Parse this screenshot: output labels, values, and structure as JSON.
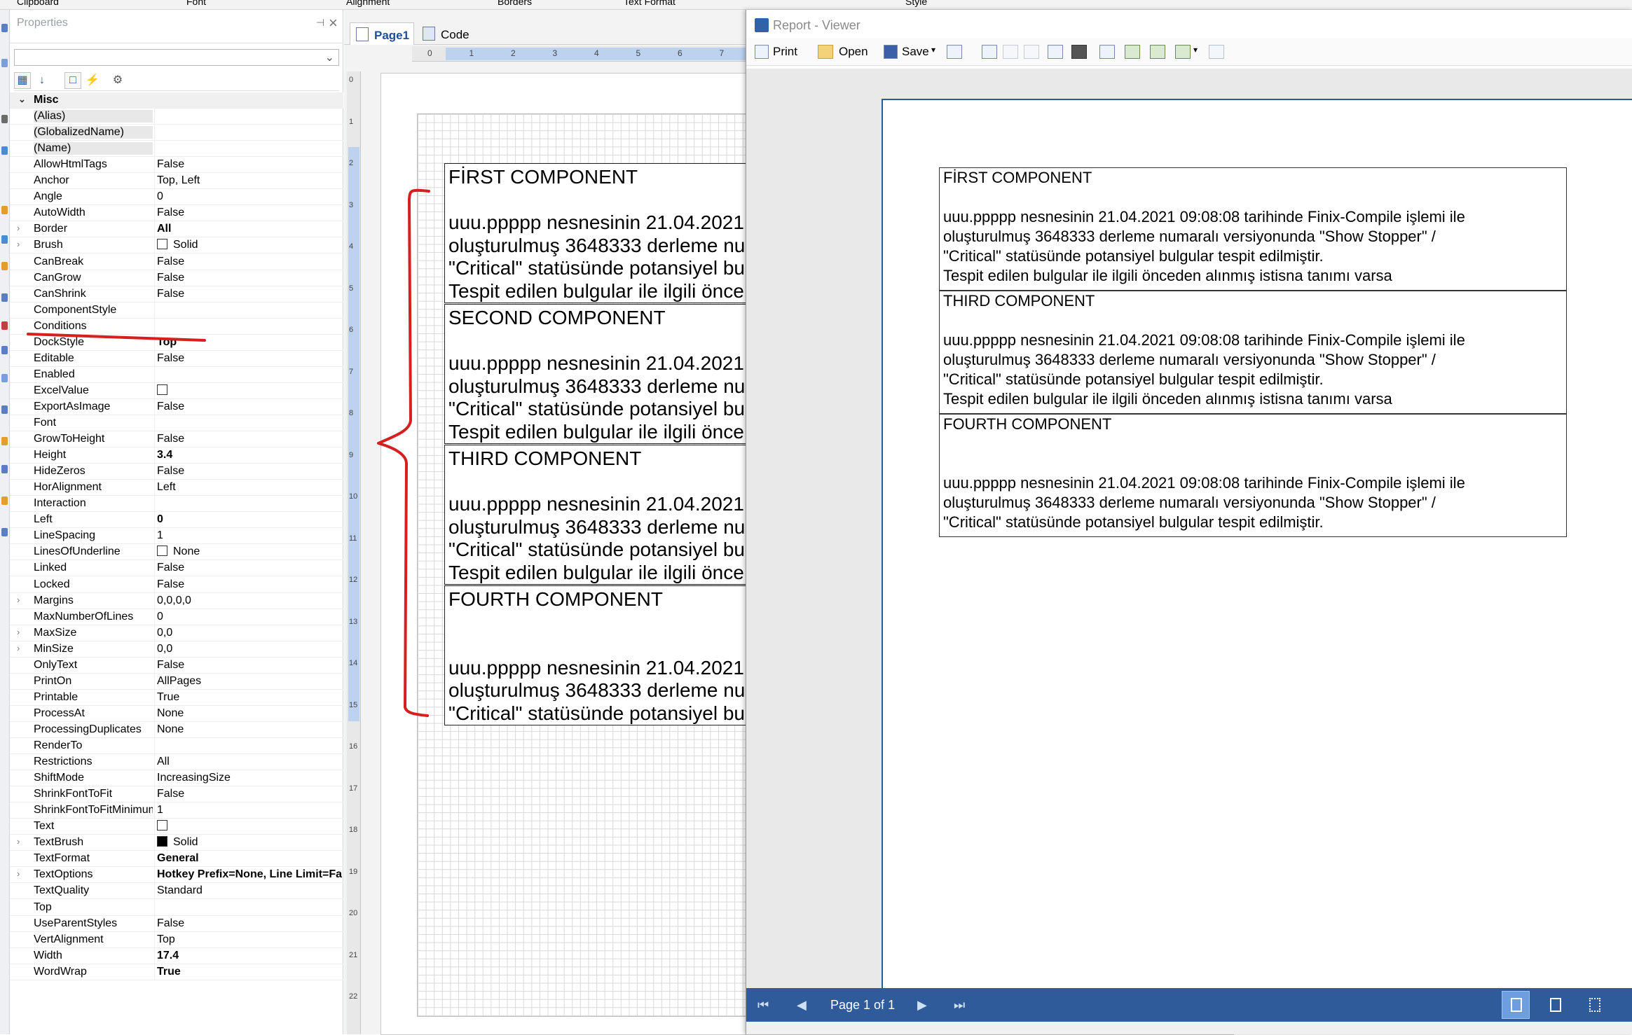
{
  "ribbon": {
    "groups": [
      "Clipboard",
      "Font",
      "Alignment",
      "Borders",
      "Text Format",
      "Style"
    ]
  },
  "properties": {
    "title": "Properties",
    "pin_icon": "pin-icon",
    "close_icon": "close-icon",
    "category": "Misc",
    "rows": [
      {
        "name": "(Alias)",
        "value": ""
      },
      {
        "name": "(GlobalizedName)",
        "value": ""
      },
      {
        "name": "(Name)",
        "value": ""
      },
      {
        "name": "AllowHtmlTags",
        "value": "False"
      },
      {
        "name": "Anchor",
        "value": "Top, Left"
      },
      {
        "name": "Angle",
        "value": "0"
      },
      {
        "name": "AutoWidth",
        "value": "False"
      },
      {
        "name": "Border",
        "value": "All"
      },
      {
        "name": "Brush",
        "value": "Solid"
      },
      {
        "name": "CanBreak",
        "value": "False"
      },
      {
        "name": "CanGrow",
        "value": "False"
      },
      {
        "name": "CanShrink",
        "value": "False"
      },
      {
        "name": "ComponentStyle",
        "value": ""
      },
      {
        "name": "Conditions",
        "value": ""
      },
      {
        "name": "DockStyle",
        "value": "Top"
      },
      {
        "name": "Editable",
        "value": "False"
      },
      {
        "name": "Enabled",
        "value": ""
      },
      {
        "name": "ExcelValue",
        "value": ""
      },
      {
        "name": "ExportAsImage",
        "value": "False"
      },
      {
        "name": "Font",
        "value": ""
      },
      {
        "name": "GrowToHeight",
        "value": "False"
      },
      {
        "name": "Height",
        "value": "3.4"
      },
      {
        "name": "HideZeros",
        "value": "False"
      },
      {
        "name": "HorAlignment",
        "value": "Left"
      },
      {
        "name": "Interaction",
        "value": ""
      },
      {
        "name": "Left",
        "value": "0"
      },
      {
        "name": "LineSpacing",
        "value": "1"
      },
      {
        "name": "LinesOfUnderline",
        "value": "None"
      },
      {
        "name": "Linked",
        "value": "False"
      },
      {
        "name": "Locked",
        "value": "False"
      },
      {
        "name": "Margins",
        "value": "0,0,0,0"
      },
      {
        "name": "MaxNumberOfLines",
        "value": "0"
      },
      {
        "name": "MaxSize",
        "value": "0,0"
      },
      {
        "name": "MinSize",
        "value": "0,0"
      },
      {
        "name": "OnlyText",
        "value": "False"
      },
      {
        "name": "PrintOn",
        "value": "AllPages"
      },
      {
        "name": "Printable",
        "value": "True"
      },
      {
        "name": "ProcessAt",
        "value": "None"
      },
      {
        "name": "ProcessingDuplicates",
        "value": "None"
      },
      {
        "name": "RenderTo",
        "value": ""
      },
      {
        "name": "Restrictions",
        "value": "All"
      },
      {
        "name": "ShiftMode",
        "value": "IncreasingSize"
      },
      {
        "name": "ShrinkFontToFit",
        "value": "False"
      },
      {
        "name": "ShrinkFontToFitMinimum",
        "value": "1"
      },
      {
        "name": "Text",
        "value": ""
      },
      {
        "name": "TextBrush",
        "value": "Solid"
      },
      {
        "name": "TextFormat",
        "value": "General"
      },
      {
        "name": "TextOptions",
        "value": "Hotkey Prefix=None, Line Limit=False"
      },
      {
        "name": "TextQuality",
        "value": "Standard"
      },
      {
        "name": "Top",
        "value": ""
      },
      {
        "name": "UseParentStyles",
        "value": "False"
      },
      {
        "name": "VertAlignment",
        "value": "Top"
      },
      {
        "name": "Width",
        "value": "17.4"
      },
      {
        "name": "WordWrap",
        "value": "True"
      }
    ]
  },
  "designer": {
    "tabs": [
      "Page1",
      "Code"
    ],
    "hruler": [
      "0",
      "1",
      "2",
      "3",
      "4",
      "5",
      "6",
      "7"
    ],
    "vruler": [
      "0",
      "1",
      "2",
      "3",
      "4",
      "5",
      "6",
      "7",
      "8",
      "9",
      "10",
      "11",
      "12",
      "13",
      "14",
      "15",
      "16",
      "17",
      "18",
      "19",
      "20",
      "21",
      "22"
    ],
    "components": [
      {
        "title": "FİRST COMPONENT",
        "lines": [
          "",
          "uuu.ppppp nesnesinin 21.04.2021",
          "oluşturulmuş 3648333 derleme nu",
          "\"Critical\" statüsünde potansiyel bu",
          "Tespit edilen bulgular ile ilgili önce"
        ]
      },
      {
        "title": "SECOND COMPONENT",
        "lines": [
          "",
          "uuu.ppppp nesnesinin 21.04.2021",
          "oluşturulmuş 3648333 derleme nu",
          "\"Critical\" statüsünde potansiyel bu",
          "Tespit edilen bulgular ile ilgili önce"
        ]
      },
      {
        "title": "THIRD  COMPONENT",
        "lines": [
          "",
          "uuu.ppppp nesnesinin 21.04.2021",
          "oluşturulmuş 3648333 derleme nu",
          "\"Critical\" statüsünde potansiyel bu",
          "Tespit edilen bulgular ile ilgili önce"
        ]
      },
      {
        "title": "FOURTH COMPONENT",
        "lines": [
          "",
          "",
          "uuu.ppppp nesnesinin 21.04.2021",
          "oluşturulmuş 3648333 derleme nu",
          "\"Critical\" statüsünde potansiyel bu"
        ]
      }
    ]
  },
  "viewer": {
    "title": "Report - Viewer",
    "toolbar": {
      "print": "Print",
      "open": "Open",
      "save": "Save"
    },
    "components": [
      {
        "title": "FİRST COMPONENT",
        "lines": [
          "",
          "uuu.ppppp  nesnesinin  21.04.2021  09:08:08  tarihinde  Finix-Compile  işlemi  ile",
          "oluşturulmuş  3648333  derleme  numaralı  versiyonunda  \"Show  Stopper\"  /",
          "\"Critical\" statüsünde potansiyel bulgular tespit edilmiştir.",
          "Tespit edilen bulgular ile ilgili önceden alınmış istisna tanımı varsa"
        ]
      },
      {
        "title": "THIRD  COMPONENT",
        "lines": [
          "",
          "uuu.ppppp  nesnesinin  21.04.2021  09:08:08  tarihinde  Finix-Compile  işlemi  ile",
          "oluşturulmuş  3648333  derleme  numaralı  versiyonunda  \"Show  Stopper\"  /",
          "\"Critical\" statüsünde potansiyel bulgular tespit edilmiştir.",
          "Tespit edilen bulgular ile ilgili önceden alınmış istisna tanımı varsa"
        ]
      },
      {
        "title": "FOURTH COMPONENT",
        "lines": [
          "",
          "",
          "uuu.ppppp  nesnesinin  21.04.2021  09:08:08  tarihinde  Finix-Compile  işlemi  ile",
          "oluşturulmuş  3648333  derleme  numaralı  versiyonunda  \"Show  Stopper\"  /",
          "\"Critical\" statüsünde potansiyel bulgular tespit edilmiştir."
        ]
      }
    ],
    "status": {
      "page_label": "Page 1 of 1"
    }
  },
  "colors": {
    "accent": "#2f5b9a",
    "annotation": "#d62020",
    "ruler_highlight": "#bcd2ef"
  }
}
